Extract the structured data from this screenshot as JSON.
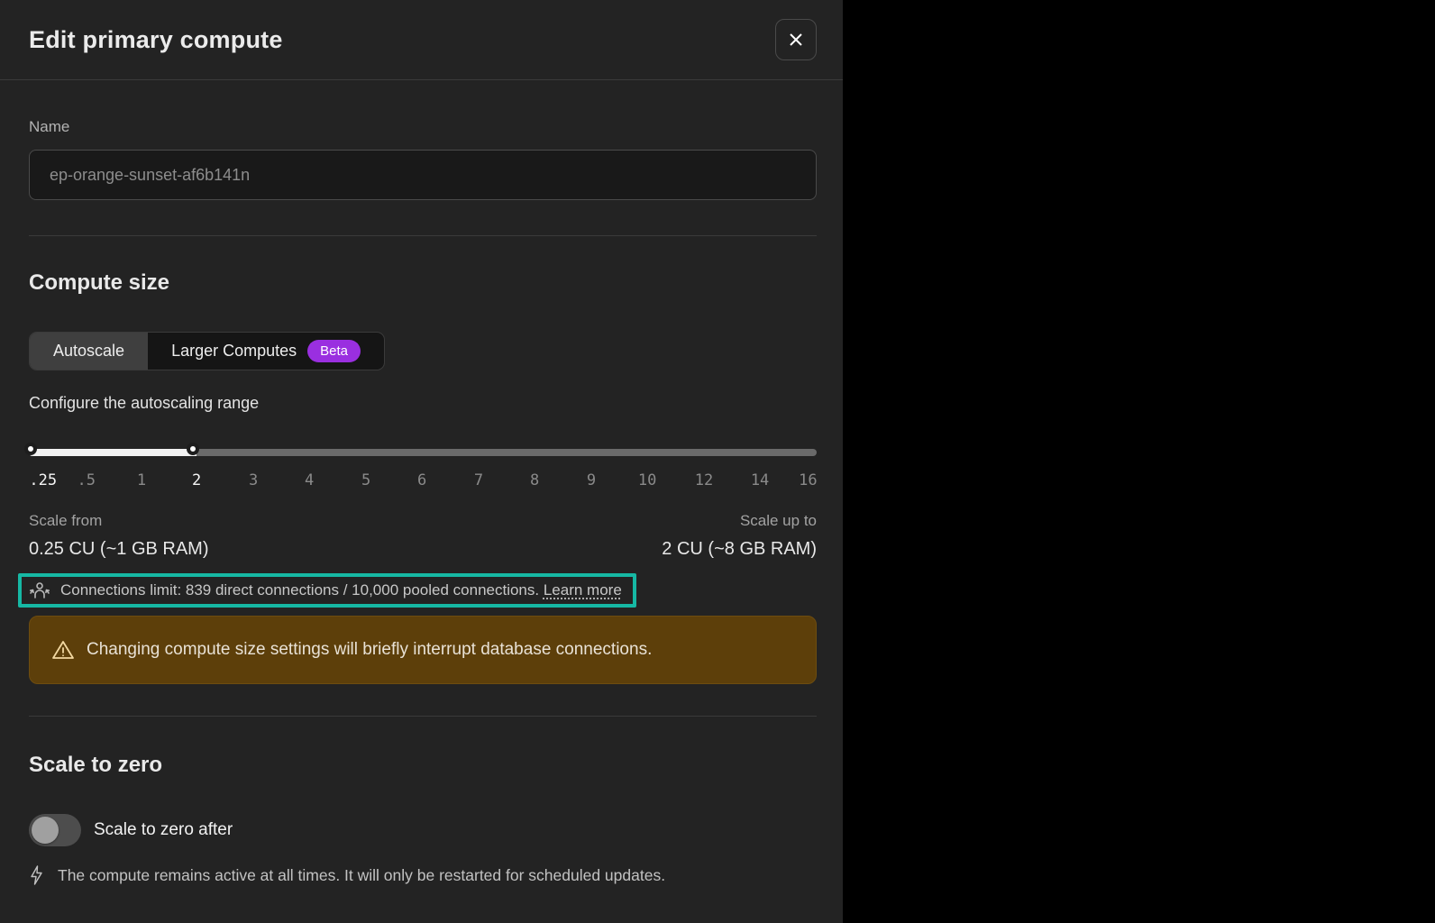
{
  "dialog": {
    "title": "Edit primary compute",
    "close_icon": "x-icon"
  },
  "name_section": {
    "label": "Name",
    "placeholder": "ep-orange-sunset-af6b141n",
    "value": ""
  },
  "compute_size": {
    "heading": "Compute size",
    "tabs": [
      {
        "label": "Autoscale",
        "selected": true
      },
      {
        "label": "Larger Computes",
        "badge": "Beta",
        "selected": false
      }
    ],
    "range_label": "Configure the autoscaling range",
    "slider": {
      "ticks": [
        ".25",
        ".5",
        "1",
        "2",
        "3",
        "4",
        "5",
        "6",
        "7",
        "8",
        "9",
        "10",
        "12",
        "14",
        "16"
      ],
      "selected_min": "0.25",
      "selected_max": "2"
    },
    "scale_from": {
      "label": "Scale from",
      "value": "0.25 CU (~1 GB RAM)"
    },
    "scale_up_to": {
      "label": "Scale up to",
      "value": "2 CU (~8 GB RAM)"
    },
    "connections_note": {
      "icon": "user-group-icon",
      "text": "Connections limit: 839 direct connections / 10,000 pooled connections.",
      "link_label": "Learn more"
    },
    "warning": {
      "icon": "warning-triangle-icon",
      "text": "Changing compute size settings will briefly interrupt database connections."
    }
  },
  "scale_to_zero": {
    "heading": "Scale to zero",
    "toggle": {
      "label": "Scale to zero after",
      "state": "off"
    },
    "note": {
      "icon": "lightning-icon",
      "text": "The compute remains active at all times. It will only be restarted for scheduled updates."
    }
  },
  "colors": {
    "panel_bg": "#232323",
    "highlight_teal": "#16b8a4",
    "beta_purple": "#9a2fe0",
    "warning_bg": "#5d3f0a",
    "warning_icon": "#f2d8a1",
    "slider_fill": "#f2f2f2",
    "slider_track": "#6a6a6a"
  }
}
